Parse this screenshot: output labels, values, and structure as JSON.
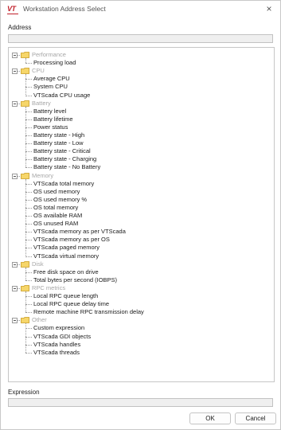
{
  "window": {
    "title": "Workstation Address Select",
    "logo_text": "VT",
    "close_glyph": "×"
  },
  "address": {
    "label": "Address",
    "value": ""
  },
  "tree": [
    {
      "category": "Performance",
      "items": [
        "Processing load"
      ]
    },
    {
      "category": "CPU",
      "items": [
        "Average CPU",
        "System CPU",
        "VTScada CPU usage"
      ]
    },
    {
      "category": "Battery",
      "items": [
        "Battery level",
        "Battery lifetime",
        "Power status",
        "Battery state - High",
        "Battery state - Low",
        "Battery state - Critical",
        "Battery state - Charging",
        "Battery state - No Battery"
      ]
    },
    {
      "category": "Memory",
      "items": [
        "VTScada total memory",
        "OS used memory",
        "OS used memory %",
        "OS total memory",
        "OS available RAM",
        "OS unused RAM",
        "VTScada memory as per VTScada",
        "VTScada memory as per OS",
        "VTScada paged memory",
        "VTScada virtual memory"
      ]
    },
    {
      "category": "Disk",
      "items": [
        "Free disk space on drive",
        "Total bytes per second (IOBPS)"
      ]
    },
    {
      "category": "RPC metrics",
      "items": [
        "Local RPC queue length",
        "Local RPC queue delay time",
        "Remote machine RPC transmission delay"
      ]
    },
    {
      "category": "Other",
      "items": [
        "Custom expression",
        "VTScada GDI objects",
        "VTScada handles",
        "VTScada threads"
      ]
    }
  ],
  "expression": {
    "label": "Expression",
    "value": ""
  },
  "buttons": {
    "ok": "OK",
    "cancel": "Cancel"
  },
  "colors": {
    "folder_fill": "#f6d66a",
    "folder_stroke": "#c99a1c",
    "category_text": "#a6a6a6",
    "logo": "#c0202a"
  },
  "icons": {
    "category": "folder-icon",
    "expander": "collapse-icon"
  }
}
